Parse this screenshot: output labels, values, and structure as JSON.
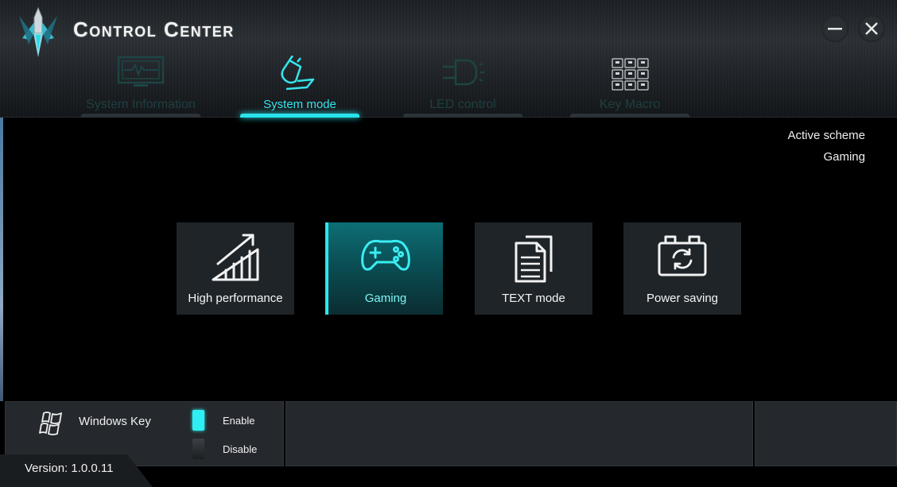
{
  "window": {
    "title": "Control Center"
  },
  "tabs": [
    {
      "label": "System Information",
      "icon": "monitor-pulse-icon",
      "active": false
    },
    {
      "label": "System mode",
      "icon": "system-mode-icon",
      "active": true
    },
    {
      "label": "LED control",
      "icon": "led-bulb-icon",
      "active": false
    },
    {
      "label": "Key Macro",
      "icon": "keypad-icon",
      "active": false
    }
  ],
  "scheme": {
    "label": "Active scheme",
    "value": "Gaming"
  },
  "modes": [
    {
      "label": "High performance",
      "icon": "performance-chart-icon",
      "active": false
    },
    {
      "label": "Gaming",
      "icon": "gamepad-icon",
      "active": true
    },
    {
      "label": "TEXT mode",
      "icon": "document-icon",
      "active": false
    },
    {
      "label": "Power saving",
      "icon": "battery-recycle-icon",
      "active": false
    }
  ],
  "windows_key": {
    "label": "Windows Key",
    "enable_label": "Enable",
    "disable_label": "Disable",
    "selected": "Enable"
  },
  "version": "Version: 1.0.0.11",
  "colors": {
    "accent": "#2ee6ee",
    "panel": "#25292d",
    "card": "#1f2428"
  }
}
